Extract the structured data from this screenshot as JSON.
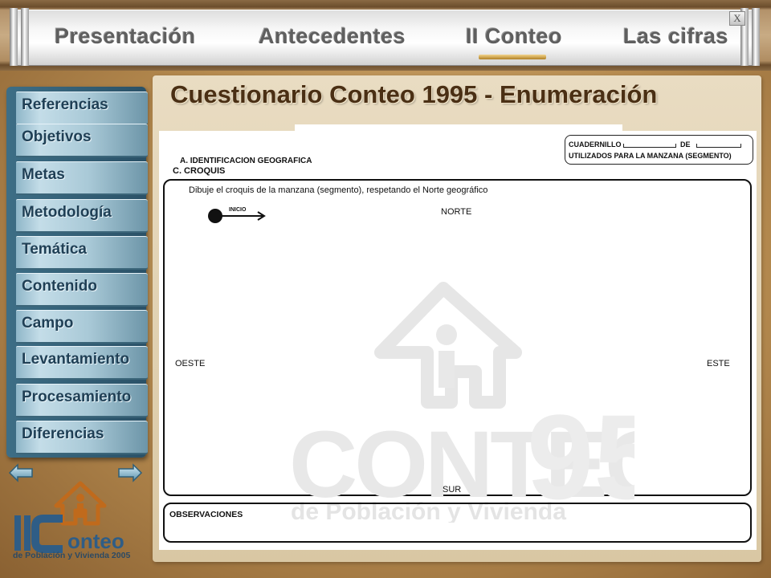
{
  "nav": {
    "items": [
      "Presentación",
      "Antecedentes",
      "II Conteo",
      "Las cifras"
    ],
    "active": "II Conteo",
    "close_label": "X"
  },
  "sidebar": {
    "items": [
      "Referencias",
      "Objetivos",
      "Metas",
      "Metodología",
      "Temática",
      "Contenido",
      "Campo",
      "Levantamiento",
      "Procesamiento",
      "Diferencias"
    ],
    "prev_icon": "arrow-left-icon",
    "next_icon": "arrow-right-icon"
  },
  "logo": {
    "title": "II Conteo",
    "subtitle": "de Población y Vivienda 2005"
  },
  "page": {
    "title": "Cuestionario Conteo 1995 - Enumeración"
  },
  "document": {
    "section_a": "A. IDENTIFICACIÓN GEOGRÁFICA",
    "cuadernillo_label": "CUADERNILLO",
    "cuadernillo_de": "DE",
    "cuadernillo_sub": "UTILIZADOS PARA LA MANZANA (SEGMENTO)",
    "section_c": "C. CROQUIS",
    "instruction": "Dibuje el croquis de la manzana (segmento), respetando el Norte geográfico",
    "inicio": "INICIO",
    "north": "NORTE",
    "south": "SUR",
    "west": "OESTE",
    "east": "ESTE",
    "observaciones": "OBSERVACIONES",
    "watermark_brand": "CONTEO",
    "watermark_year": "95",
    "watermark_sub": "de Población y Vivienda"
  },
  "colors": {
    "title": "#4a2f14",
    "menu_text": "#1f3f55",
    "menu_frame": "#2a5167",
    "nav_text": "#5f5f5f",
    "active_bar": "#d4a84a"
  }
}
